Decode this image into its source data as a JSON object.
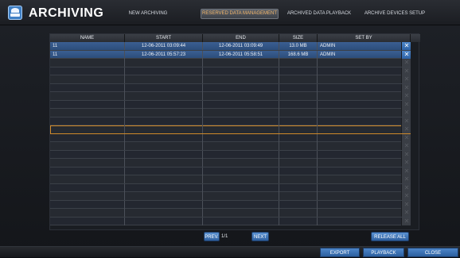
{
  "header": {
    "title": "ARCHIVING",
    "tabs": [
      {
        "label": "NEW ARCHIVING"
      },
      {
        "label": "RESERVED DATA MANAGEMENT"
      },
      {
        "label": "ARCHIVED DATA PLAYBACK"
      },
      {
        "label": "ARCHIVE DEVICES SETUP"
      }
    ],
    "active_tab": "RESERVED DATA MANAGEMENT"
  },
  "table": {
    "columns": [
      "NAME",
      "START",
      "END",
      "SIZE",
      "SET BY"
    ],
    "rows": [
      {
        "name": "11",
        "start": "12-06-2011  03:09:44",
        "end": "12-06-2011  03:09:49",
        "size": "13.0 MB",
        "set_by": "ADMIN"
      },
      {
        "name": "11",
        "start": "12-06-2011  05:57:23",
        "end": "12-06-2011  05:58:51",
        "size": "168.6 MB",
        "set_by": "ADMIN"
      }
    ],
    "empty_rows": 20,
    "delete_icon": "close-icon"
  },
  "pager": {
    "prev_label": "PREV.",
    "page_text": "1/1",
    "next_label": "NEXT",
    "release_all_label": "RELEASE ALL"
  },
  "footer": {
    "export_label": "EXPORT",
    "playback_label": "PLAYBACK",
    "close_label": "CLOSE"
  },
  "colors": {
    "accent": "#3f7fc4",
    "active_tab_text": "#f2b66a",
    "focus_outline": "#d08a2a"
  }
}
